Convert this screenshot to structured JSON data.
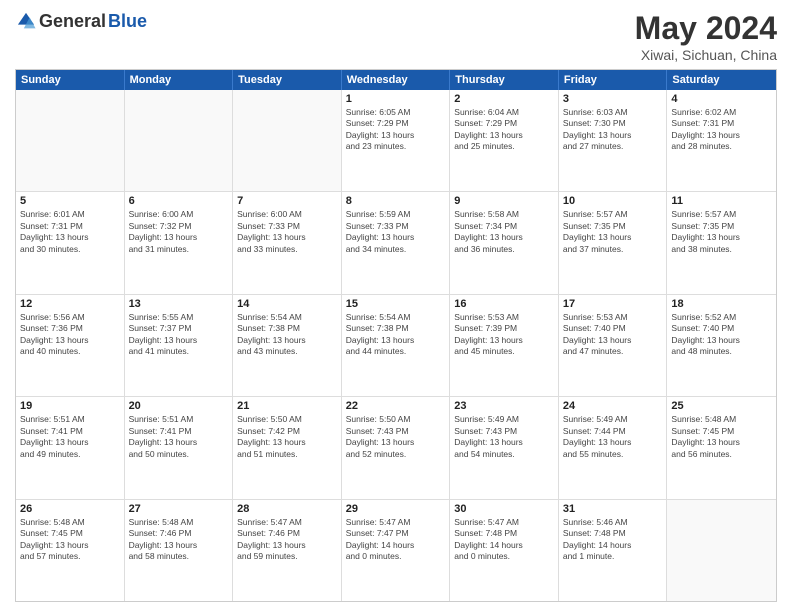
{
  "header": {
    "logo_general": "General",
    "logo_blue": "Blue",
    "month_year": "May 2024",
    "location": "Xiwai, Sichuan, China"
  },
  "weekdays": [
    "Sunday",
    "Monday",
    "Tuesday",
    "Wednesday",
    "Thursday",
    "Friday",
    "Saturday"
  ],
  "rows": [
    [
      {
        "day": "",
        "text": "",
        "empty": true
      },
      {
        "day": "",
        "text": "",
        "empty": true
      },
      {
        "day": "",
        "text": "",
        "empty": true
      },
      {
        "day": "1",
        "text": "Sunrise: 6:05 AM\nSunset: 7:29 PM\nDaylight: 13 hours\nand 23 minutes."
      },
      {
        "day": "2",
        "text": "Sunrise: 6:04 AM\nSunset: 7:29 PM\nDaylight: 13 hours\nand 25 minutes."
      },
      {
        "day": "3",
        "text": "Sunrise: 6:03 AM\nSunset: 7:30 PM\nDaylight: 13 hours\nand 27 minutes."
      },
      {
        "day": "4",
        "text": "Sunrise: 6:02 AM\nSunset: 7:31 PM\nDaylight: 13 hours\nand 28 minutes."
      }
    ],
    [
      {
        "day": "5",
        "text": "Sunrise: 6:01 AM\nSunset: 7:31 PM\nDaylight: 13 hours\nand 30 minutes."
      },
      {
        "day": "6",
        "text": "Sunrise: 6:00 AM\nSunset: 7:32 PM\nDaylight: 13 hours\nand 31 minutes."
      },
      {
        "day": "7",
        "text": "Sunrise: 6:00 AM\nSunset: 7:33 PM\nDaylight: 13 hours\nand 33 minutes."
      },
      {
        "day": "8",
        "text": "Sunrise: 5:59 AM\nSunset: 7:33 PM\nDaylight: 13 hours\nand 34 minutes."
      },
      {
        "day": "9",
        "text": "Sunrise: 5:58 AM\nSunset: 7:34 PM\nDaylight: 13 hours\nand 36 minutes."
      },
      {
        "day": "10",
        "text": "Sunrise: 5:57 AM\nSunset: 7:35 PM\nDaylight: 13 hours\nand 37 minutes."
      },
      {
        "day": "11",
        "text": "Sunrise: 5:57 AM\nSunset: 7:35 PM\nDaylight: 13 hours\nand 38 minutes."
      }
    ],
    [
      {
        "day": "12",
        "text": "Sunrise: 5:56 AM\nSunset: 7:36 PM\nDaylight: 13 hours\nand 40 minutes."
      },
      {
        "day": "13",
        "text": "Sunrise: 5:55 AM\nSunset: 7:37 PM\nDaylight: 13 hours\nand 41 minutes."
      },
      {
        "day": "14",
        "text": "Sunrise: 5:54 AM\nSunset: 7:38 PM\nDaylight: 13 hours\nand 43 minutes."
      },
      {
        "day": "15",
        "text": "Sunrise: 5:54 AM\nSunset: 7:38 PM\nDaylight: 13 hours\nand 44 minutes."
      },
      {
        "day": "16",
        "text": "Sunrise: 5:53 AM\nSunset: 7:39 PM\nDaylight: 13 hours\nand 45 minutes."
      },
      {
        "day": "17",
        "text": "Sunrise: 5:53 AM\nSunset: 7:40 PM\nDaylight: 13 hours\nand 47 minutes."
      },
      {
        "day": "18",
        "text": "Sunrise: 5:52 AM\nSunset: 7:40 PM\nDaylight: 13 hours\nand 48 minutes."
      }
    ],
    [
      {
        "day": "19",
        "text": "Sunrise: 5:51 AM\nSunset: 7:41 PM\nDaylight: 13 hours\nand 49 minutes."
      },
      {
        "day": "20",
        "text": "Sunrise: 5:51 AM\nSunset: 7:41 PM\nDaylight: 13 hours\nand 50 minutes."
      },
      {
        "day": "21",
        "text": "Sunrise: 5:50 AM\nSunset: 7:42 PM\nDaylight: 13 hours\nand 51 minutes."
      },
      {
        "day": "22",
        "text": "Sunrise: 5:50 AM\nSunset: 7:43 PM\nDaylight: 13 hours\nand 52 minutes."
      },
      {
        "day": "23",
        "text": "Sunrise: 5:49 AM\nSunset: 7:43 PM\nDaylight: 13 hours\nand 54 minutes."
      },
      {
        "day": "24",
        "text": "Sunrise: 5:49 AM\nSunset: 7:44 PM\nDaylight: 13 hours\nand 55 minutes."
      },
      {
        "day": "25",
        "text": "Sunrise: 5:48 AM\nSunset: 7:45 PM\nDaylight: 13 hours\nand 56 minutes."
      }
    ],
    [
      {
        "day": "26",
        "text": "Sunrise: 5:48 AM\nSunset: 7:45 PM\nDaylight: 13 hours\nand 57 minutes."
      },
      {
        "day": "27",
        "text": "Sunrise: 5:48 AM\nSunset: 7:46 PM\nDaylight: 13 hours\nand 58 minutes."
      },
      {
        "day": "28",
        "text": "Sunrise: 5:47 AM\nSunset: 7:46 PM\nDaylight: 13 hours\nand 59 minutes."
      },
      {
        "day": "29",
        "text": "Sunrise: 5:47 AM\nSunset: 7:47 PM\nDaylight: 14 hours\nand 0 minutes."
      },
      {
        "day": "30",
        "text": "Sunrise: 5:47 AM\nSunset: 7:48 PM\nDaylight: 14 hours\nand 0 minutes."
      },
      {
        "day": "31",
        "text": "Sunrise: 5:46 AM\nSunset: 7:48 PM\nDaylight: 14 hours\nand 1 minute."
      },
      {
        "day": "",
        "text": "",
        "empty": true
      }
    ]
  ]
}
